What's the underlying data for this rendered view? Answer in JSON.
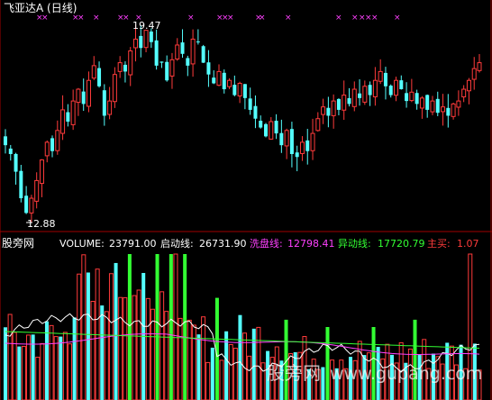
{
  "title": "飞亚达A (日线)",
  "price_panel": {
    "high_label": "19.47",
    "low_label": "12.88"
  },
  "indicator_panel": {
    "site_label": "股旁网",
    "volume": {
      "label": "VOLUME:",
      "value": "23791.00"
    },
    "qidong": {
      "label": "启动线:",
      "value": "26731.90"
    },
    "xipan": {
      "label": "洗盘线:",
      "value": "12798.41"
    },
    "yidong": {
      "label": "异动线:",
      "value": "17720.79"
    },
    "zhumai": {
      "label": "主买:",
      "value": "1.07"
    }
  },
  "watermark": {
    "cn": "股旁网",
    "url": "www.gupang.com"
  },
  "colors": {
    "up": "#ff3b3b",
    "down": "#54ffff",
    "mark": "#ff40ff",
    "green": "#33ff33",
    "white": "#ffffff",
    "magenta": "#ff40ff"
  },
  "chart_data": {
    "type": "candlestick",
    "high": 19.47,
    "low": 12.88,
    "close": [
      15.4,
      15.1,
      14.5,
      13.6,
      13.1,
      13.6,
      14.2,
      14.9,
      15.5,
      15.2,
      15.9,
      16.6,
      16.2,
      16.9,
      17.3,
      16.8,
      17.6,
      18.1,
      17.4,
      16.4,
      16.9,
      17.8,
      18.2,
      17.9,
      18.6,
      19.0,
      18.7,
      19.3,
      18.9,
      18.1,
      18.2,
      17.6,
      18.3,
      18.8,
      18.5,
      18.1,
      19.0,
      18.9,
      18.2,
      17.8,
      17.5,
      17.9,
      17.3,
      17.6,
      17.1,
      17.5,
      17.0,
      16.6,
      16.3,
      16.0,
      15.7,
      16.2,
      15.8,
      15.4,
      15.9,
      15.1,
      15.0,
      15.5,
      15.2,
      15.8,
      16.3,
      16.7,
      16.4,
      16.9,
      16.6,
      17.1,
      16.8,
      17.3,
      17.0,
      17.4,
      17.1,
      17.6,
      17.9,
      17.4,
      17.1,
      17.6,
      17.3,
      16.9,
      17.2,
      16.8,
      17.0,
      16.6,
      16.9,
      16.5,
      16.7,
      16.4,
      16.8,
      16.9,
      17.3,
      17.6,
      18.0,
      18.2
    ],
    "volume_series": [
      "VOLUME",
      "启动线",
      "洗盘线",
      "异动线",
      "主买"
    ]
  }
}
